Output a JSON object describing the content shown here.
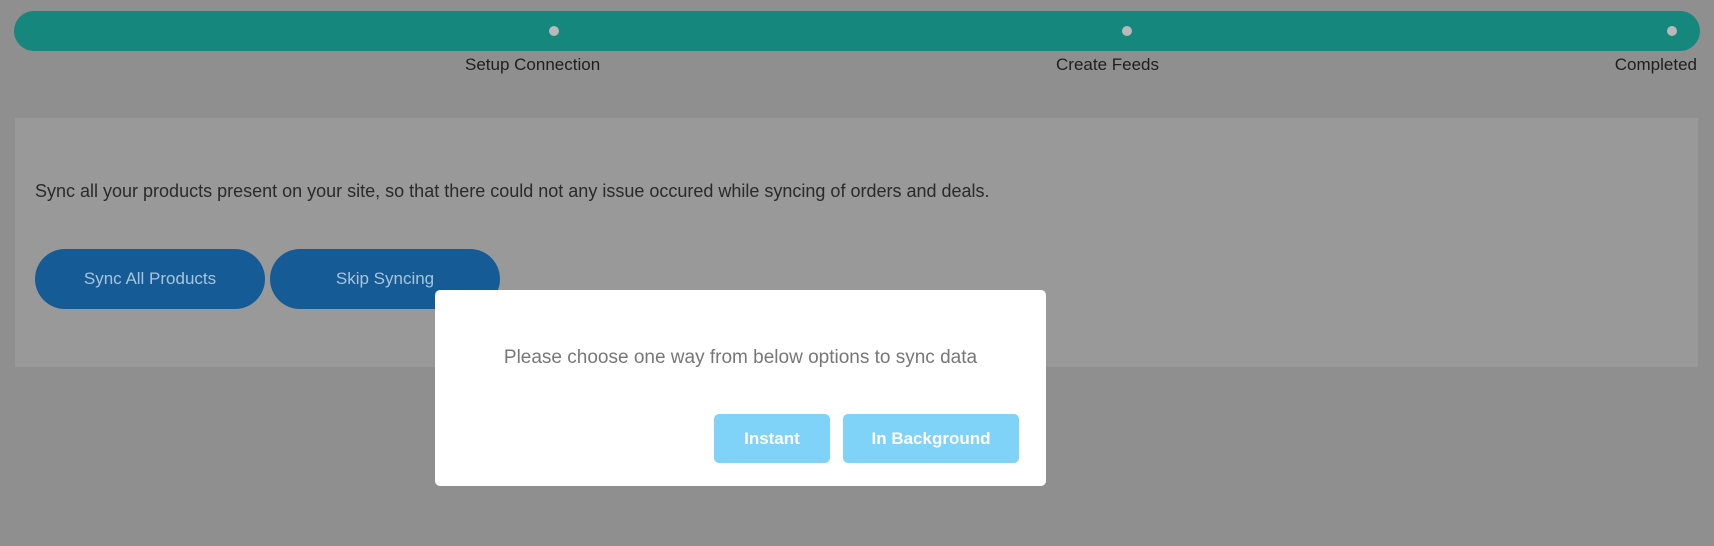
{
  "progress": {
    "steps": [
      {
        "label": "Setup Connection"
      },
      {
        "label": "Create Feeds"
      },
      {
        "label": "Completed"
      }
    ],
    "completion_percent": 100
  },
  "panel": {
    "description": "Sync all your products present on your site, so that there could not any issue occured while syncing of orders and deals.",
    "sync_all_label": "Sync All Products",
    "skip_label": "Skip Syncing"
  },
  "modal": {
    "message": "Please choose one way from below options to sync data",
    "instant_label": "Instant",
    "background_label": "In Background"
  },
  "colors": {
    "progress": "#15877c",
    "primary_button": "#155c96",
    "modal_button": "#7fd2f8"
  }
}
